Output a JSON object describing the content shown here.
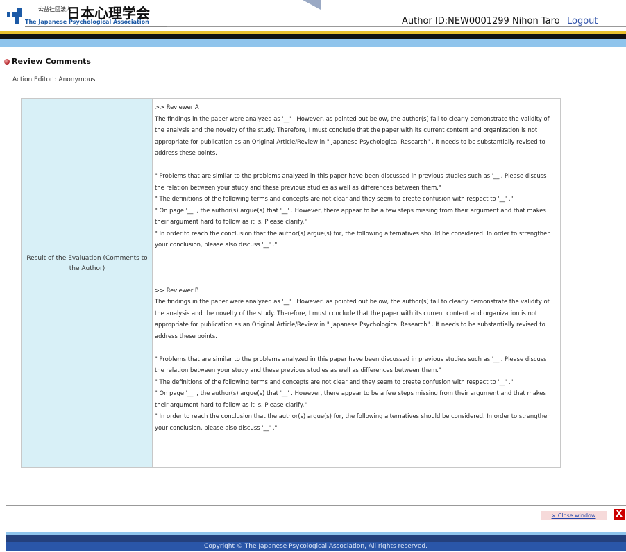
{
  "header": {
    "logo_small": "公益社団法人",
    "logo_big": "日本心理学会",
    "logo_en": "The Japanese Psychological Association",
    "author_info": "Author  ID:NEW0001299 Nihon Taro",
    "logout": "Logout"
  },
  "section": {
    "title": "Review Comments",
    "editor_line": "Action Editor : Anonymous"
  },
  "table": {
    "label": "Result of the Evaluation (Comments to the Author)",
    "reviewers": [
      {
        "title": ">> Reviewer A",
        "para1": "The findings in the paper were analyzed as '__' . However, as pointed out below, the author(s) fail to clearly demonstrate the validity of the analysis and the novelty of the study. Therefore, I must conclude that the paper with its current content and organization is not appropriate for publication as an Original Article/Review in \" Japanese Psychological Research\" . It needs to be substantially revised to address these points.",
        "quote1": "\" Problems that are similar to the problems analyzed in this paper have been discussed in previous studies such as '__'. Please discuss the relation between your study and these previous studies as well as differences between them.\"",
        "quote2": "\" The definitions of the following terms and concepts are not clear and they seem to create confusion with respect to '__' .\"",
        "quote3": "\" On page '__' , the author(s) argue(s) that '__' . However, there appear to be a few steps missing from their argument and that makes their argument hard to follow as it is. Please clarify.\"",
        "quote4": "\" In order to reach the conclusion that the author(s) argue(s) for, the following alternatives should be considered. In order to strengthen your conclusion, please also discuss '__' .\""
      },
      {
        "title": ">> Reviewer B",
        "para1": "The findings in the paper were analyzed as '__' . However, as pointed out below, the author(s) fail to clearly demonstrate the validity of the analysis and the novelty of the study. Therefore, I must conclude that the paper with its current content and organization is not appropriate for publication as an Original Article/Review in \" Japanese Psychological Research\" . It needs to be substantially revised to address these points.",
        "quote1": "\" Problems that are similar to the problems analyzed in this paper have been discussed in previous studies such as '__'. Please discuss the relation between your study and these previous studies as well as differences between them.\"",
        "quote2": "\" The definitions of the following terms and concepts are not clear and they seem to create confusion with respect to '__' .\"",
        "quote3": "\" On page '__' , the author(s) argue(s) that '__' . However, there appear to be a few steps missing from their argument and that makes their argument hard to follow as it is. Please clarify.\"",
        "quote4": "\" In order to reach the conclusion that the author(s) argue(s) for, the following alternatives should be considered. In order to strengthen your conclusion, please also discuss '__' .\""
      }
    ]
  },
  "footer": {
    "close_label": "× Close window",
    "close_icon": "X",
    "copyright": "Copyright © The Japanese Psycological Association, All rights reserved."
  },
  "colors": {
    "accent_blue": "#2a56a8",
    "label_bg": "#d8f0f7",
    "logout_link": "#3355aa",
    "close_red": "#cc0000"
  }
}
